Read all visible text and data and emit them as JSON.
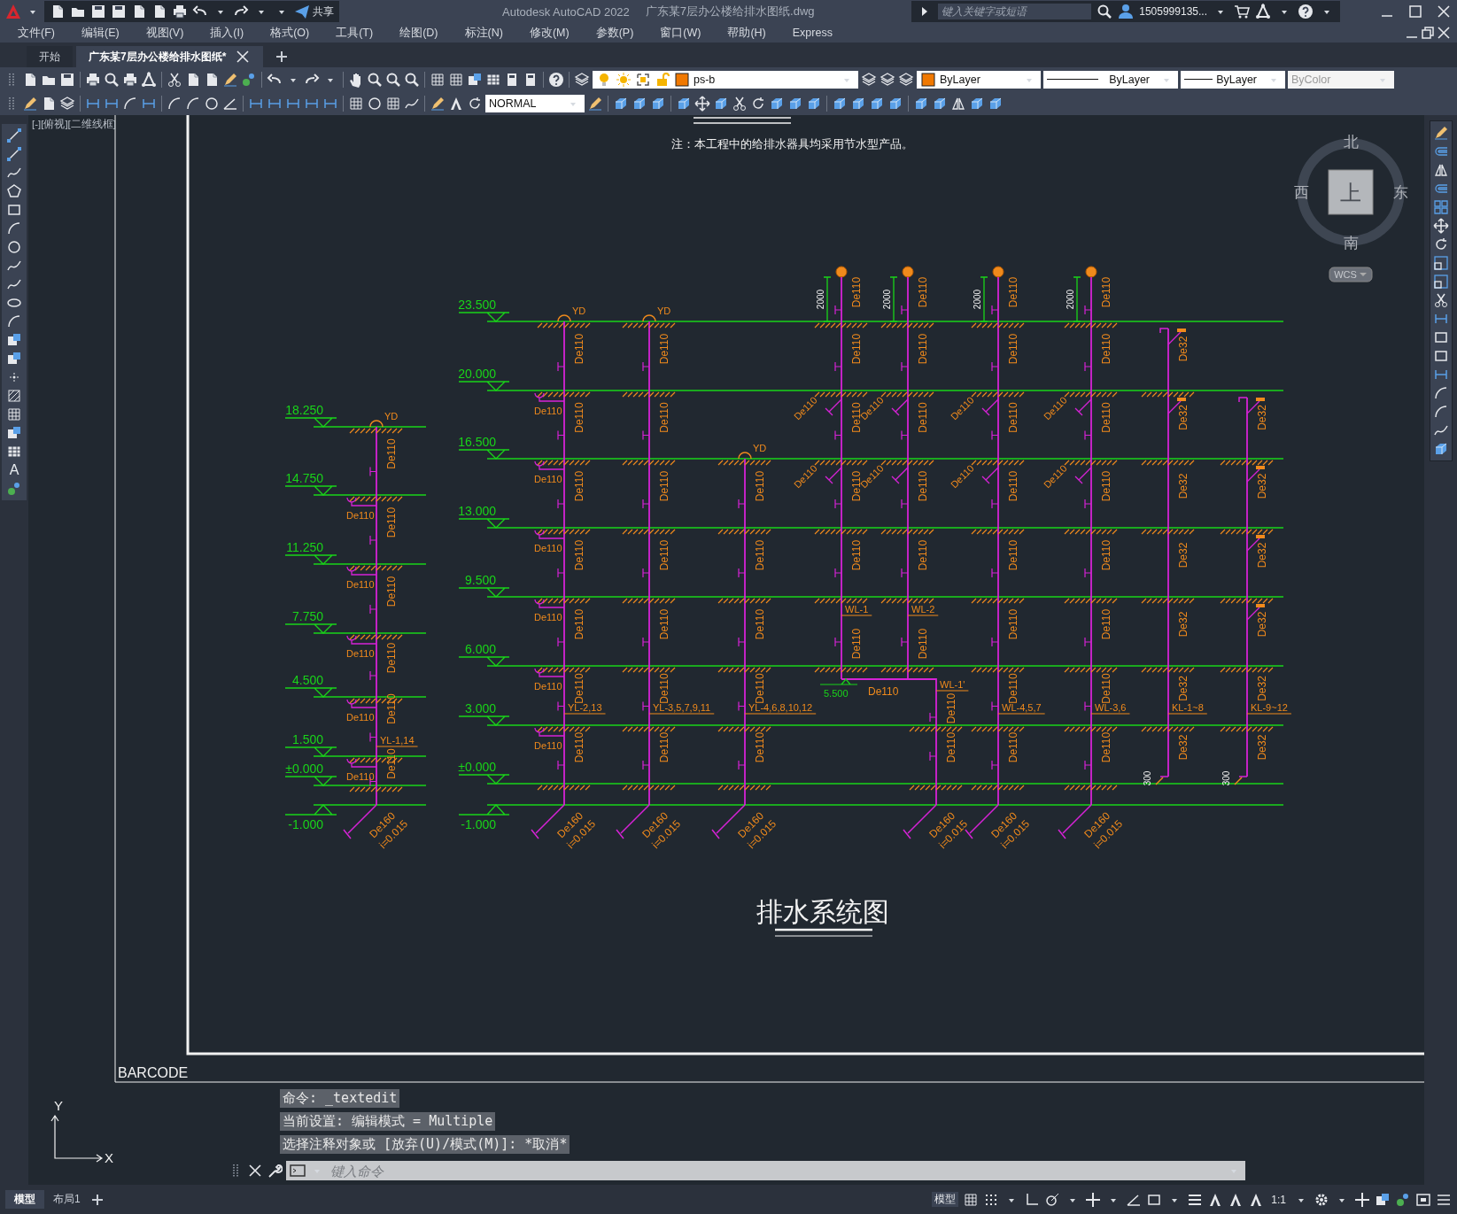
{
  "title_bar": {
    "share": "共享",
    "app_title": "Autodesk AutoCAD 2022",
    "file_name": "广东某7层办公楼给排水图纸.dwg",
    "search_placeholder": "键入关键字或短语",
    "user": "1505999135..."
  },
  "menu": [
    "文件(F)",
    "编辑(E)",
    "视图(V)",
    "插入(I)",
    "格式(O)",
    "工具(T)",
    "绘图(D)",
    "标注(N)",
    "修改(M)",
    "参数(P)",
    "窗口(W)",
    "帮助(H)",
    "Express"
  ],
  "doc_tabs": [
    {
      "label": "开始",
      "selected": false
    },
    {
      "label": "广东某7层办公楼给排水图纸*",
      "selected": true
    }
  ],
  "properties": {
    "layer": "ps-b",
    "color_setting": "ByLayer",
    "linetype": "ByLayer",
    "lineweight": "ByLayer",
    "plot_style": {
      "value": "ByColor",
      "disabled": true
    },
    "text_style": "NORMAL"
  },
  "draw_toolbar": {
    "text_tool": "A"
  },
  "viewport_label": "[-][俯视][二维线框]",
  "drawing": {
    "note": "注：本工程中的给排水器具均采用节水型产品。",
    "title": "排水系统图",
    "barcode": "BARCODE",
    "left_system": {
      "elevations": [
        "18.250",
        "14.750",
        "11.250",
        "7.750",
        "4.500",
        "1.500",
        "±0.000",
        "-1.000"
      ],
      "riser": {
        "kind": "roof_drain",
        "top_label": "YD",
        "pipe_labels": [
          "De110",
          "De110",
          "De110",
          "De110",
          "De110",
          "De110"
        ],
        "branch_labels": [
          "De110",
          "De110",
          "De110",
          "De110",
          "De110"
        ],
        "tag": "YL-1,14",
        "outlet_size": "De160",
        "outlet_slope": "i=0.015"
      }
    },
    "main_system": {
      "elevations": [
        "23.500",
        "20.000",
        "16.500",
        "13.000",
        "9.500",
        "6.000",
        "3.000",
        "±0.000",
        "-1.000"
      ],
      "risers": [
        {
          "kind": "roof_drain",
          "top_label": "YD",
          "pipe_labels": [
            "De110",
            "De110",
            "De110",
            "De110",
            "De110",
            "De110",
            "De110"
          ],
          "branch_labels": [
            "De110",
            "De110",
            "De110",
            "De110",
            "De110",
            "De110"
          ],
          "tag": "YL-2,13",
          "outlet_size": "De160",
          "outlet_slope": "i=0.015"
        },
        {
          "kind": "roof_drain",
          "top_label": "YD",
          "pipe_labels": [
            "De110",
            "De110",
            "De110",
            "De110",
            "De110",
            "De110",
            "De110"
          ],
          "tag": "YL-3,5,7,9,11",
          "outlet_size": "De160",
          "outlet_slope": "i=0.015"
        },
        {
          "kind": "roof_drain",
          "top_label": "YD",
          "pipe_labels": [
            "De110",
            "De110",
            "De110",
            "De110",
            "De110"
          ],
          "tag": "YL-4,6,8,10,12",
          "outlet_size": "De160",
          "outlet_slope": "i=0.015"
        },
        {
          "kind": "vent",
          "dimension": "2000",
          "pipe_labels": [
            "De110",
            "De110",
            "De110",
            "De110",
            "De110",
            "De110"
          ],
          "branch_labels": [
            "De110",
            "De110"
          ],
          "tag": "WL-1"
        },
        {
          "kind": "vent",
          "dimension": "2000",
          "pipe_labels": [
            "De110",
            "De110",
            "De110",
            "De110",
            "De110",
            "De110"
          ],
          "branch_labels": [
            "De110",
            "De110"
          ],
          "tag": "WL-2"
        },
        {
          "kind": "vent",
          "dimension": "2000",
          "pipe_labels": [
            "De110",
            "De110",
            "De110",
            "De110",
            "De110",
            "De110",
            "De110",
            "De110"
          ],
          "branch_labels": [
            "De110",
            "De110"
          ],
          "tag": "WL-4,5,7",
          "outlet_size": "De160",
          "outlet_slope": "i=0.015"
        },
        {
          "kind": "vent",
          "dimension": "2000",
          "pipe_labels": [
            "De110",
            "De110",
            "De110",
            "De110",
            "De110",
            "De110",
            "De110",
            "De110"
          ],
          "branch_labels": [
            "De110",
            "De110"
          ],
          "tag": "WL-3,6",
          "outlet_size": "De160",
          "outlet_slope": "i=0.015"
        },
        {
          "kind": "condensate",
          "dimension": "300",
          "pipe_labels": [
            "De32",
            "De32",
            "De32",
            "De32",
            "De32",
            "De32",
            "De32"
          ],
          "tag": "KL-1~8"
        },
        {
          "kind": "condensate",
          "dimension": "300",
          "pipe_labels": [
            "De32",
            "De32",
            "De32",
            "De32",
            "De32",
            "De32"
          ],
          "tag": "KL-9~12"
        }
      ],
      "offset": {
        "elevation": "5.500",
        "pipe_label": "De110",
        "tag": "WL-1'",
        "pipe_labels": [
          "De110",
          "De110"
        ],
        "outlet_size": "De160",
        "outlet_slope": "i=0.015"
      }
    }
  },
  "viewcube": {
    "north": "北",
    "west": "西",
    "east": "东",
    "south": "南",
    "face": "上",
    "ucs": "WCS"
  },
  "ucs_icon": {
    "y": "Y",
    "x": "X"
  },
  "command": {
    "history": [
      "命令: _textedit",
      "当前设置: 编辑模式 = Multiple",
      "选择注释对象或 [放弃(U)/模式(M)]: *取消*"
    ],
    "placeholder": "键入命令"
  },
  "layout_tabs": [
    {
      "label": "模型",
      "selected": true
    },
    {
      "label": "布局1",
      "selected": false
    }
  ],
  "status_bar": {
    "space": "模型",
    "scale": "1:1"
  }
}
